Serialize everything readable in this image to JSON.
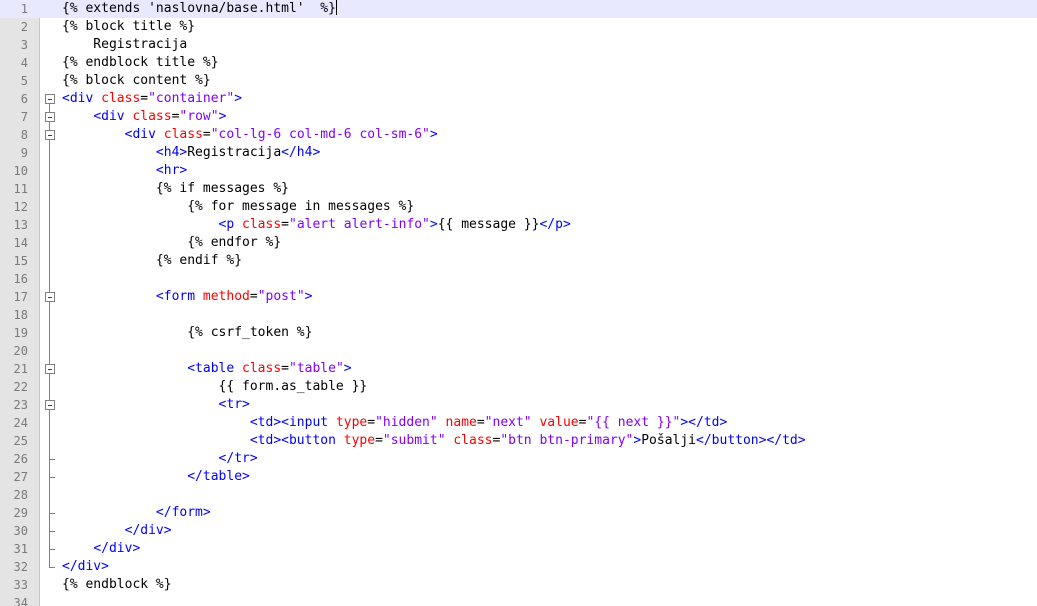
{
  "editor": {
    "caret_line": 1,
    "lines": [
      {
        "n": "1",
        "fold": "",
        "tokens": [
          [
            "django",
            "{% extends 'naslovna/base.html'  %}"
          ]
        ]
      },
      {
        "n": "2",
        "fold": "",
        "tokens": [
          [
            "django",
            "{% block title %}"
          ]
        ]
      },
      {
        "n": "3",
        "fold": "",
        "tokens": [
          [
            "text",
            "    Registracija"
          ]
        ]
      },
      {
        "n": "4",
        "fold": "",
        "tokens": [
          [
            "django",
            "{% endblock title %}"
          ]
        ]
      },
      {
        "n": "5",
        "fold": "",
        "tokens": [
          [
            "django",
            "{% block content %}"
          ]
        ]
      },
      {
        "n": "6",
        "fold": "open",
        "tokens": [
          [
            "tag",
            "<div "
          ],
          [
            "attr",
            "class"
          ],
          [
            "eq",
            "="
          ],
          [
            "str",
            "\"container\""
          ],
          [
            "tag",
            ">"
          ]
        ]
      },
      {
        "n": "7",
        "fold": "open",
        "tokens": [
          [
            "text",
            "    "
          ],
          [
            "tag",
            "<div "
          ],
          [
            "attr",
            "class"
          ],
          [
            "eq",
            "="
          ],
          [
            "str",
            "\"row\""
          ],
          [
            "tag",
            ">"
          ]
        ]
      },
      {
        "n": "8",
        "fold": "open",
        "tokens": [
          [
            "text",
            "        "
          ],
          [
            "tag",
            "<div "
          ],
          [
            "attr",
            "class"
          ],
          [
            "eq",
            "="
          ],
          [
            "str",
            "\"col-lg-6 col-md-6 col-sm-6\""
          ],
          [
            "tag",
            ">"
          ]
        ]
      },
      {
        "n": "9",
        "fold": "line",
        "tokens": [
          [
            "text",
            "            "
          ],
          [
            "tag",
            "<h4>"
          ],
          [
            "text",
            "Registracija"
          ],
          [
            "tag",
            "</h4>"
          ]
        ]
      },
      {
        "n": "10",
        "fold": "line",
        "tokens": [
          [
            "text",
            "            "
          ],
          [
            "tag",
            "<hr>"
          ]
        ]
      },
      {
        "n": "11",
        "fold": "line",
        "tokens": [
          [
            "text",
            "            "
          ],
          [
            "django",
            "{% if messages %}"
          ]
        ]
      },
      {
        "n": "12",
        "fold": "line",
        "tokens": [
          [
            "text",
            "                "
          ],
          [
            "django",
            "{% for message in messages %}"
          ]
        ]
      },
      {
        "n": "13",
        "fold": "line",
        "tokens": [
          [
            "text",
            "                    "
          ],
          [
            "tag",
            "<p "
          ],
          [
            "attr",
            "class"
          ],
          [
            "eq",
            "="
          ],
          [
            "str",
            "\"alert alert-info\""
          ],
          [
            "tag",
            ">"
          ],
          [
            "text",
            "{{ message }}"
          ],
          [
            "tag",
            "</p>"
          ]
        ]
      },
      {
        "n": "14",
        "fold": "line",
        "tokens": [
          [
            "text",
            "                "
          ],
          [
            "django",
            "{% endfor %}"
          ]
        ]
      },
      {
        "n": "15",
        "fold": "line",
        "tokens": [
          [
            "text",
            "            "
          ],
          [
            "django",
            "{% endif %}"
          ]
        ]
      },
      {
        "n": "16",
        "fold": "line",
        "tokens": []
      },
      {
        "n": "17",
        "fold": "open",
        "tokens": [
          [
            "text",
            "            "
          ],
          [
            "tag",
            "<form "
          ],
          [
            "attr",
            "method"
          ],
          [
            "eq",
            "="
          ],
          [
            "str",
            "\"post\""
          ],
          [
            "tag",
            ">"
          ]
        ]
      },
      {
        "n": "18",
        "fold": "line",
        "tokens": []
      },
      {
        "n": "19",
        "fold": "line",
        "tokens": [
          [
            "text",
            "                "
          ],
          [
            "django",
            "{% csrf_token %}"
          ]
        ]
      },
      {
        "n": "20",
        "fold": "line",
        "tokens": []
      },
      {
        "n": "21",
        "fold": "open",
        "tokens": [
          [
            "text",
            "                "
          ],
          [
            "tag",
            "<table "
          ],
          [
            "attr",
            "class"
          ],
          [
            "eq",
            "="
          ],
          [
            "str",
            "\"table\""
          ],
          [
            "tag",
            ">"
          ]
        ]
      },
      {
        "n": "22",
        "fold": "line",
        "tokens": [
          [
            "text",
            "                    {{ form.as_table }}"
          ]
        ]
      },
      {
        "n": "23",
        "fold": "open",
        "tokens": [
          [
            "text",
            "                    "
          ],
          [
            "tag",
            "<tr>"
          ]
        ]
      },
      {
        "n": "24",
        "fold": "line",
        "tokens": [
          [
            "text",
            "                        "
          ],
          [
            "tag",
            "<td><input "
          ],
          [
            "attr",
            "type"
          ],
          [
            "eq",
            "="
          ],
          [
            "str",
            "\"hidden\""
          ],
          [
            "text",
            " "
          ],
          [
            "attr",
            "name"
          ],
          [
            "eq",
            "="
          ],
          [
            "str",
            "\"next\""
          ],
          [
            "text",
            " "
          ],
          [
            "attr",
            "value"
          ],
          [
            "eq",
            "="
          ],
          [
            "str",
            "\"{{ next }}\""
          ],
          [
            "tag",
            "></td>"
          ]
        ]
      },
      {
        "n": "25",
        "fold": "line",
        "tokens": [
          [
            "text",
            "                        "
          ],
          [
            "tag",
            "<td><button "
          ],
          [
            "attr",
            "type"
          ],
          [
            "eq",
            "="
          ],
          [
            "str",
            "\"submit\""
          ],
          [
            "text",
            " "
          ],
          [
            "attr",
            "class"
          ],
          [
            "eq",
            "="
          ],
          [
            "str",
            "\"btn btn-primary\""
          ],
          [
            "tag",
            ">"
          ],
          [
            "text",
            "Pošalji"
          ],
          [
            "tag",
            "</button></td>"
          ]
        ]
      },
      {
        "n": "26",
        "fold": "end",
        "tokens": [
          [
            "text",
            "                    "
          ],
          [
            "tag",
            "</tr>"
          ]
        ]
      },
      {
        "n": "27",
        "fold": "end",
        "tokens": [
          [
            "text",
            "                "
          ],
          [
            "tag",
            "</table>"
          ]
        ]
      },
      {
        "n": "28",
        "fold": "line",
        "tokens": []
      },
      {
        "n": "29",
        "fold": "end",
        "tokens": [
          [
            "text",
            "            "
          ],
          [
            "tag",
            "</form>"
          ]
        ]
      },
      {
        "n": "30",
        "fold": "end",
        "tokens": [
          [
            "text",
            "        "
          ],
          [
            "tag",
            "</div>"
          ]
        ]
      },
      {
        "n": "31",
        "fold": "end",
        "tokens": [
          [
            "text",
            "    "
          ],
          [
            "tag",
            "</div>"
          ]
        ]
      },
      {
        "n": "32",
        "fold": "end",
        "tokens": [
          [
            "tag",
            "</div>"
          ]
        ]
      },
      {
        "n": "33",
        "fold": "",
        "tokens": [
          [
            "django",
            "{% endblock %}"
          ]
        ]
      },
      {
        "n": "34",
        "fold": "",
        "tokens": []
      }
    ]
  }
}
